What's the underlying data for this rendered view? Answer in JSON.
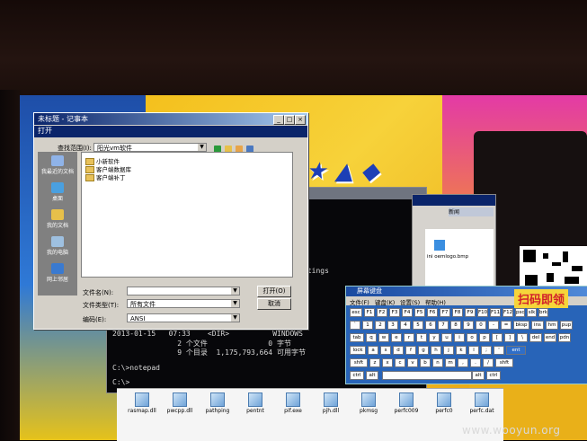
{
  "dialog": {
    "title": "未标题 - 记事本",
    "inner_title": "打开",
    "look_in_label": "查找范围(I):",
    "look_in_value": "阳光vm软件",
    "files": [
      "小新软件",
      "客户端数据库",
      "客户端补丁"
    ],
    "places": [
      "我最近的文档",
      "桌面",
      "我的文档",
      "我的电脑",
      "网上邻居"
    ],
    "filename_label": "文件名(N):",
    "filename_value": "",
    "filetype_label": "文件类型(T):",
    "filetype_value": "所有文件",
    "encoding_label": "编码(E):",
    "encoding_value": "ANSI",
    "open_button": "打开(O)",
    "cancel_button": "取消"
  },
  "cmd": {
    "lines": [
      "ttings",
      "2013-01-15   07:33    <DIR>          WINDOWS",
      "               2 个文件              0 字节",
      "               9 个目录  1,175,793,664 可用字节",
      "",
      "C:\\>notepad",
      "",
      "C:\\>"
    ]
  },
  "explorer": {
    "item_label": "ini  oemlogo.bmp",
    "tab_label": "新闻"
  },
  "osk": {
    "title": "屏幕键盘",
    "menus": [
      "文件(F)",
      "键盘(K)",
      "设置(S)",
      "帮助(H)"
    ],
    "rows": [
      [
        "esc",
        "F1",
        "F2",
        "F3",
        "F4",
        "F5",
        "F6",
        "F7",
        "F8",
        "F9",
        "F10",
        "F11",
        "F12",
        "psc",
        "slk",
        "brk"
      ],
      [
        "`",
        "1",
        "2",
        "3",
        "4",
        "5",
        "6",
        "7",
        "8",
        "9",
        "0",
        "-",
        "=",
        "bksp",
        "ins",
        "hm",
        "pup"
      ],
      [
        "tab",
        "q",
        "w",
        "e",
        "r",
        "t",
        "y",
        "u",
        "i",
        "o",
        "p",
        "[",
        "]",
        "\\",
        "del",
        "end",
        "pdn"
      ],
      [
        "lock",
        "a",
        "s",
        "d",
        "f",
        "g",
        "h",
        "j",
        "k",
        "l",
        ";",
        "'",
        "ent"
      ],
      [
        "shft",
        "z",
        "x",
        "c",
        "v",
        "b",
        "n",
        "m",
        ",",
        ".",
        "/",
        "shft"
      ],
      [
        "ctrl",
        "alt",
        "alt",
        "ctrl"
      ]
    ]
  },
  "iconstrip": {
    "items": [
      "rasmap.dll",
      "pwcpp.dll",
      "pathping",
      "pentnt",
      "pif.exe",
      "pjh.dll",
      "pkmsg",
      "perfc009",
      "perfc0",
      "perfc.dat"
    ]
  },
  "wallpaper": {
    "scan_text": "扫码即领",
    "watermark": "www.wooyun.org"
  }
}
